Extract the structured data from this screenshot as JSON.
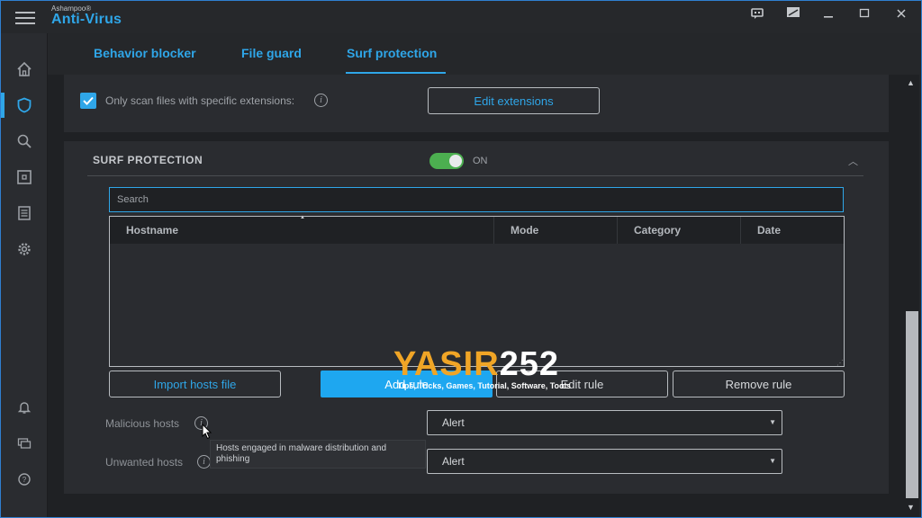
{
  "app": {
    "vendor": "Ashampoo®",
    "name": "Anti-Virus"
  },
  "tabs": [
    {
      "label": "Behavior blocker"
    },
    {
      "label": "File guard"
    },
    {
      "label": "Surf protection",
      "active": true
    }
  ],
  "extensions": {
    "checked": true,
    "label": "Only scan files with specific extensions:",
    "button": "Edit extensions"
  },
  "surf": {
    "title": "SURF PROTECTION",
    "toggle_state": "ON",
    "search_placeholder": "Search",
    "columns": [
      "Hostname",
      "Mode",
      "Category",
      "Date"
    ],
    "buttons": {
      "import": "Import hosts file",
      "add": "Add rule",
      "edit": "Edit rule",
      "remove": "Remove rule"
    },
    "malicious_label": "Malicious hosts",
    "malicious_value": "Alert",
    "unwanted_label": "Unwanted hosts",
    "unwanted_value": "Alert",
    "tooltip": "Hosts engaged in malware distribution and phishing"
  },
  "watermark": {
    "part1": "YASIR",
    "part2": "252",
    "sub": "Tips, Tricks, Games, Tutorial, Software, Tools"
  },
  "colors": {
    "accent": "#2fa6e8",
    "toggle_on": "#4caf50",
    "primary_button": "#1ea7f0"
  },
  "icons": {
    "menu": "hamburger-icon",
    "sidebar": [
      "home-icon",
      "shield-icon",
      "search-icon",
      "scan-icon",
      "log-icon",
      "settings-icon",
      "bell-icon",
      "chat-icon",
      "help-icon"
    ],
    "titlebar": [
      "feedback-icon",
      "screen-icon",
      "minimize-icon",
      "maximize-icon",
      "close-icon"
    ]
  }
}
